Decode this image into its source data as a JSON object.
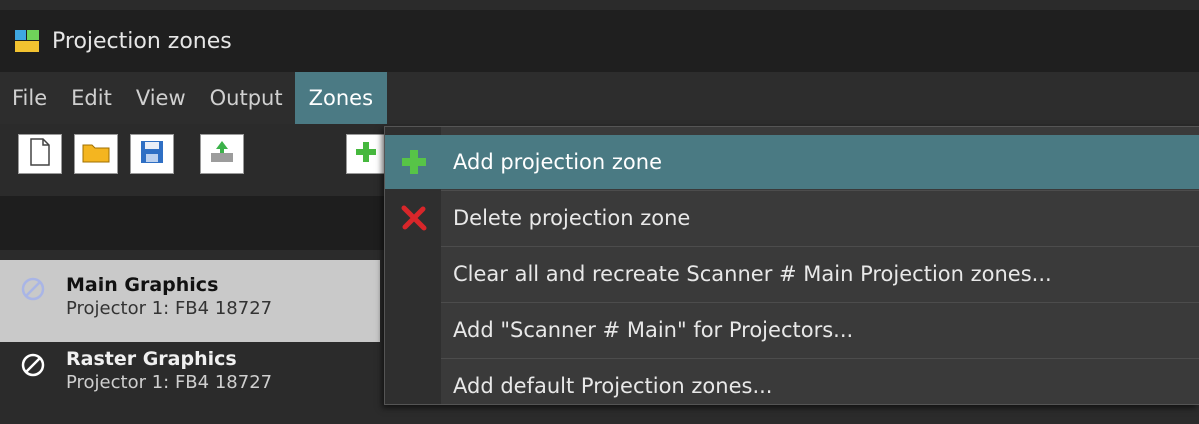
{
  "window": {
    "title": "Projection zones",
    "icon": "app-icon"
  },
  "menubar": {
    "items": [
      {
        "label": "File"
      },
      {
        "label": "Edit"
      },
      {
        "label": "View"
      },
      {
        "label": "Output"
      },
      {
        "label": "Zones",
        "active": true
      }
    ]
  },
  "toolbar": {
    "buttons": [
      {
        "icon": "new-file-icon"
      },
      {
        "icon": "open-folder-icon"
      },
      {
        "icon": "save-icon"
      },
      {
        "icon": "projector-icon"
      },
      {
        "icon": "add-icon"
      }
    ]
  },
  "zones_list": [
    {
      "title": "Main Graphics",
      "subtitle": "Projector 1: FB4 18727",
      "selected": true,
      "icon": "disabled-circle-icon"
    },
    {
      "title": "Raster Graphics",
      "subtitle": "Projector 1: FB4 18727",
      "selected": false,
      "icon": "disabled-circle-icon"
    }
  ],
  "zones_menu": {
    "items": [
      {
        "label": "Add projection zone",
        "icon": "green-plus-icon",
        "highlighted": true
      },
      {
        "label": "Delete projection zone",
        "icon": "red-x-icon"
      },
      {
        "label": "Clear all and recreate Scanner # Main Projection zones..."
      },
      {
        "label": "Add \"Scanner # Main\" for Projectors..."
      },
      {
        "label": "Add default Projection zones..."
      }
    ]
  },
  "colors": {
    "menu_highlight": "#4a7a83",
    "titlebar_bg": "#1f1f1f",
    "selected_row_bg": "#c9c9c9"
  }
}
